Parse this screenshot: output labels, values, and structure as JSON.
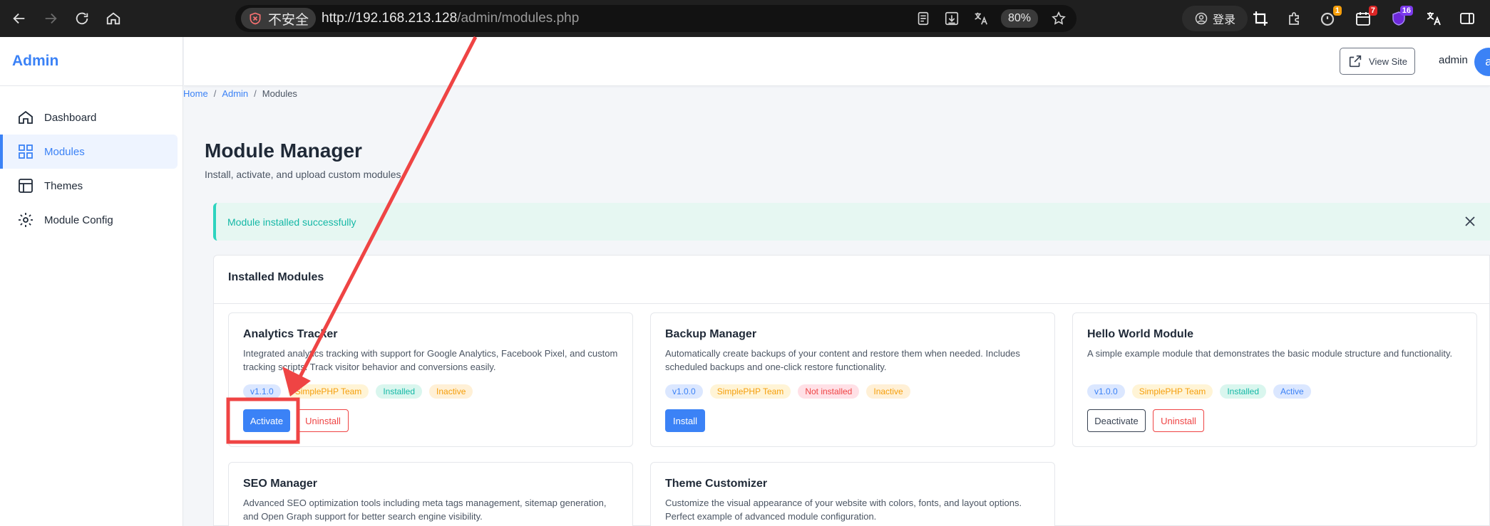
{
  "browser": {
    "security_label": "不安全",
    "url_host": "http://192.168.213.128",
    "url_path": "/admin/modules.php",
    "zoom": "80%",
    "login_label": "登录",
    "ext_badges": [
      "1",
      "7",
      "16"
    ]
  },
  "sidebar": {
    "brand": "Admin",
    "items": [
      {
        "label": "Dashboard",
        "icon": "home-icon",
        "active": false
      },
      {
        "label": "Modules",
        "icon": "grid-icon",
        "active": true
      },
      {
        "label": "Themes",
        "icon": "layout-icon",
        "active": false
      },
      {
        "label": "Module Config",
        "icon": "gear-icon",
        "active": false
      }
    ]
  },
  "topbar": {
    "view_site": "View Site",
    "user": "admin",
    "avatar_initial": "a"
  },
  "breadcrumb": [
    "Home",
    "Admin",
    "Modules"
  ],
  "page": {
    "title": "Module Manager",
    "subtitle": "Install, activate, and upload custom modules"
  },
  "alert": {
    "message": "Module installed successfully"
  },
  "installed": {
    "title": "Installed Modules",
    "modules": [
      {
        "name": "Analytics Tracker",
        "description": "Integrated analytics tracking with support for Google Analytics, Facebook Pixel, and custom tracking scripts. Track visitor behavior and conversions easily.",
        "version": "v1.1.0",
        "author": "SimplePHP Team",
        "install_status": "Installed",
        "active_status": "Inactive",
        "actions": [
          "Activate",
          "Uninstall"
        ]
      },
      {
        "name": "Backup Manager",
        "description": "Automatically create backups of your content and restore them when needed. Includes scheduled backups and one-click restore functionality.",
        "version": "v1.0.0",
        "author": "SimplePHP Team",
        "install_status": "Not installed",
        "active_status": "Inactive",
        "actions": [
          "Install"
        ]
      },
      {
        "name": "Hello World Module",
        "description": "A simple example module that demonstrates the basic module structure and functionality.",
        "version": "v1.0.0",
        "author": "SimplePHP Team",
        "install_status": "Installed",
        "active_status": "Active",
        "actions": [
          "Deactivate",
          "Uninstall"
        ]
      },
      {
        "name": "SEO Manager",
        "description": "Advanced SEO optimization tools including meta tags management, sitemap generation, and Open Graph support for better search engine visibility."
      },
      {
        "name": "Theme Customizer",
        "description": "Customize the visual appearance of your website with colors, fonts, and layout options. Perfect example of advanced module configuration."
      }
    ]
  },
  "colors": {
    "accent": "#3b82f6",
    "success": "#14b8a6",
    "danger": "#ef4444",
    "annotation": "#ef4444"
  }
}
